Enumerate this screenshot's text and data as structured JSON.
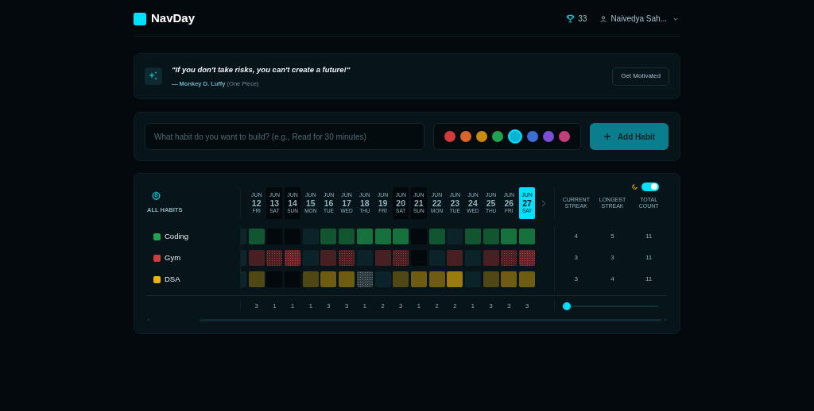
{
  "brand": {
    "name": "NavDay"
  },
  "header": {
    "trophy_count": "33",
    "user_name": "Naivedya Sah..."
  },
  "quote": {
    "text": "\"If you don't take risks, you can't create a future!\"",
    "author": "— Monkey D. Luffy",
    "source": "(One Piece)",
    "button": "Get Motivated"
  },
  "new_habit": {
    "placeholder": "What habit do you want to build? (e.g., Read for 30 minutes)",
    "button": "Add Habit",
    "colors": [
      {
        "color": "#d13b3b",
        "selected": false
      },
      {
        "color": "#d8642b",
        "selected": false
      },
      {
        "color": "#ca8a0a",
        "selected": false
      },
      {
        "color": "#1fa34e",
        "selected": false
      },
      {
        "color": "#0bb4d2",
        "selected": true
      },
      {
        "color": "#3b6fd6",
        "selected": false
      },
      {
        "color": "#7a4fd4",
        "selected": false
      },
      {
        "color": "#c43f7a",
        "selected": false
      }
    ]
  },
  "tracker": {
    "title": "ALL HABITS",
    "dark_mode": true,
    "days": [
      {
        "month": "JUN",
        "day": "12",
        "weekday": "FRI",
        "weekend": false,
        "selected": false
      },
      {
        "month": "JUN",
        "day": "13",
        "weekday": "SAT",
        "weekend": true,
        "selected": false
      },
      {
        "month": "JUN",
        "day": "14",
        "weekday": "SUN",
        "weekend": true,
        "selected": false
      },
      {
        "month": "JUN",
        "day": "15",
        "weekday": "MON",
        "weekend": false,
        "selected": false
      },
      {
        "month": "JUN",
        "day": "16",
        "weekday": "TUE",
        "weekend": false,
        "selected": false
      },
      {
        "month": "JUN",
        "day": "17",
        "weekday": "WED",
        "weekend": false,
        "selected": false
      },
      {
        "month": "JUN",
        "day": "18",
        "weekday": "THU",
        "weekend": false,
        "selected": false
      },
      {
        "month": "JUN",
        "day": "19",
        "weekday": "FRI",
        "weekend": false,
        "selected": false
      },
      {
        "month": "JUN",
        "day": "20",
        "weekday": "SAT",
        "weekend": true,
        "selected": false
      },
      {
        "month": "JUN",
        "day": "21",
        "weekday": "SUN",
        "weekend": true,
        "selected": false
      },
      {
        "month": "JUN",
        "day": "22",
        "weekday": "MON",
        "weekend": false,
        "selected": false
      },
      {
        "month": "JUN",
        "day": "23",
        "weekday": "TUE",
        "weekend": false,
        "selected": false
      },
      {
        "month": "JUN",
        "day": "24",
        "weekday": "WED",
        "weekend": false,
        "selected": false
      },
      {
        "month": "JUN",
        "day": "25",
        "weekday": "THU",
        "weekend": false,
        "selected": false
      },
      {
        "month": "JUN",
        "day": "26",
        "weekday": "FRI",
        "weekend": false,
        "selected": false
      },
      {
        "month": "JUN",
        "day": "27",
        "weekday": "SAT",
        "weekend": true,
        "selected": true
      }
    ],
    "stat_columns": [
      "CURRENT STREAK",
      "LONGEST STREAK",
      "TOTAL COUNT"
    ],
    "habits": [
      {
        "name": "Coding",
        "color": "#1fa34e",
        "current_streak": "4",
        "longest_streak": "5",
        "total_count": "11",
        "cells": [
          {
            "kind": "mid"
          },
          {
            "kind": "empty"
          },
          {
            "kind": "empty"
          },
          {
            "kind": "empty"
          },
          {
            "kind": "mid"
          },
          {
            "kind": "mid"
          },
          {
            "kind": "high"
          },
          {
            "kind": "high"
          },
          {
            "kind": "high"
          },
          {
            "kind": "empty"
          },
          {
            "kind": "mid"
          },
          {
            "kind": "empty"
          },
          {
            "kind": "mid"
          },
          {
            "kind": "mid"
          },
          {
            "kind": "high"
          },
          {
            "kind": "high"
          }
        ]
      },
      {
        "name": "Gym",
        "color": "#d13b3b",
        "current_streak": "3",
        "longest_streak": "3",
        "total_count": "11",
        "cells": [
          {
            "kind": "low"
          },
          {
            "kind": "dotted"
          },
          {
            "kind": "dense"
          },
          {
            "kind": "empty"
          },
          {
            "kind": "low"
          },
          {
            "kind": "dotted"
          },
          {
            "kind": "empty"
          },
          {
            "kind": "low"
          },
          {
            "kind": "dotted"
          },
          {
            "kind": "empty"
          },
          {
            "kind": "empty"
          },
          {
            "kind": "low"
          },
          {
            "kind": "empty"
          },
          {
            "kind": "low"
          },
          {
            "kind": "dotted"
          },
          {
            "kind": "dense"
          }
        ]
      },
      {
        "name": "DSA",
        "color": "#eab308",
        "current_streak": "3",
        "longest_streak": "4",
        "total_count": "11",
        "cells": [
          {
            "kind": "low"
          },
          {
            "kind": "empty"
          },
          {
            "kind": "empty"
          },
          {
            "kind": "low"
          },
          {
            "kind": "mid"
          },
          {
            "kind": "mid"
          },
          {
            "kind": "frozen"
          },
          {
            "kind": "empty"
          },
          {
            "kind": "low"
          },
          {
            "kind": "mid"
          },
          {
            "kind": "mid"
          },
          {
            "kind": "high"
          },
          {
            "kind": "empty"
          },
          {
            "kind": "low"
          },
          {
            "kind": "mid"
          },
          {
            "kind": "mid"
          }
        ]
      }
    ],
    "daily_totals": [
      "3",
      "1",
      "1",
      "1",
      "3",
      "3",
      "1",
      "2",
      "3",
      "1",
      "2",
      "2",
      "1",
      "3",
      "3",
      "3"
    ],
    "zoom": {
      "level": 0
    }
  }
}
